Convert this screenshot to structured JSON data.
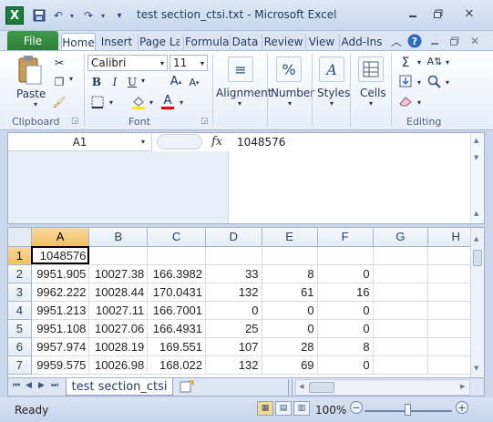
{
  "window": {
    "title": "test section_ctsi.txt  -  Microsoft Excel",
    "app_icon": "X"
  },
  "tabs": [
    "File",
    "Home",
    "Insert",
    "Page La",
    "Formula",
    "Data",
    "Review",
    "View",
    "Add-Ins"
  ],
  "ribbon": {
    "clipboard": {
      "paste": "Paste",
      "label": "Clipboard"
    },
    "font": {
      "name": "Calibri",
      "size": "11",
      "label": "Font"
    },
    "alignment": "Alignment",
    "number": "Number",
    "styles": "Styles",
    "cells": "Cells",
    "editing": "Editing"
  },
  "formula_bar": {
    "name_box": "A1",
    "fx": "fx",
    "value": "1048576"
  },
  "grid": {
    "columns": [
      "A",
      "B",
      "C",
      "D",
      "E",
      "F",
      "G",
      "H"
    ],
    "rows": [
      {
        "num": "1",
        "cells": [
          "1048576",
          "",
          "",
          "",
          "",
          "",
          "",
          ""
        ]
      },
      {
        "num": "2",
        "cells": [
          "9951.905",
          "10027.38",
          "166.3982",
          "33",
          "8",
          "0",
          "",
          ""
        ]
      },
      {
        "num": "3",
        "cells": [
          "9962.222",
          "10028.44",
          "170.0431",
          "132",
          "61",
          "16",
          "",
          ""
        ]
      },
      {
        "num": "4",
        "cells": [
          "9951.213",
          "10027.11",
          "166.7001",
          "0",
          "0",
          "0",
          "",
          ""
        ]
      },
      {
        "num": "5",
        "cells": [
          "9951.108",
          "10027.06",
          "166.4931",
          "25",
          "0",
          "0",
          "",
          ""
        ]
      },
      {
        "num": "6",
        "cells": [
          "9957.974",
          "10028.19",
          "169.551",
          "107",
          "28",
          "8",
          "",
          ""
        ]
      },
      {
        "num": "7",
        "cells": [
          "9959.575",
          "10026.98",
          "168.022",
          "132",
          "69",
          "0",
          "",
          ""
        ]
      }
    ]
  },
  "sheet_tab": "test section_ctsi",
  "status": {
    "text": "Ready",
    "zoom": "100%",
    "zoom_level_pct": 100
  }
}
